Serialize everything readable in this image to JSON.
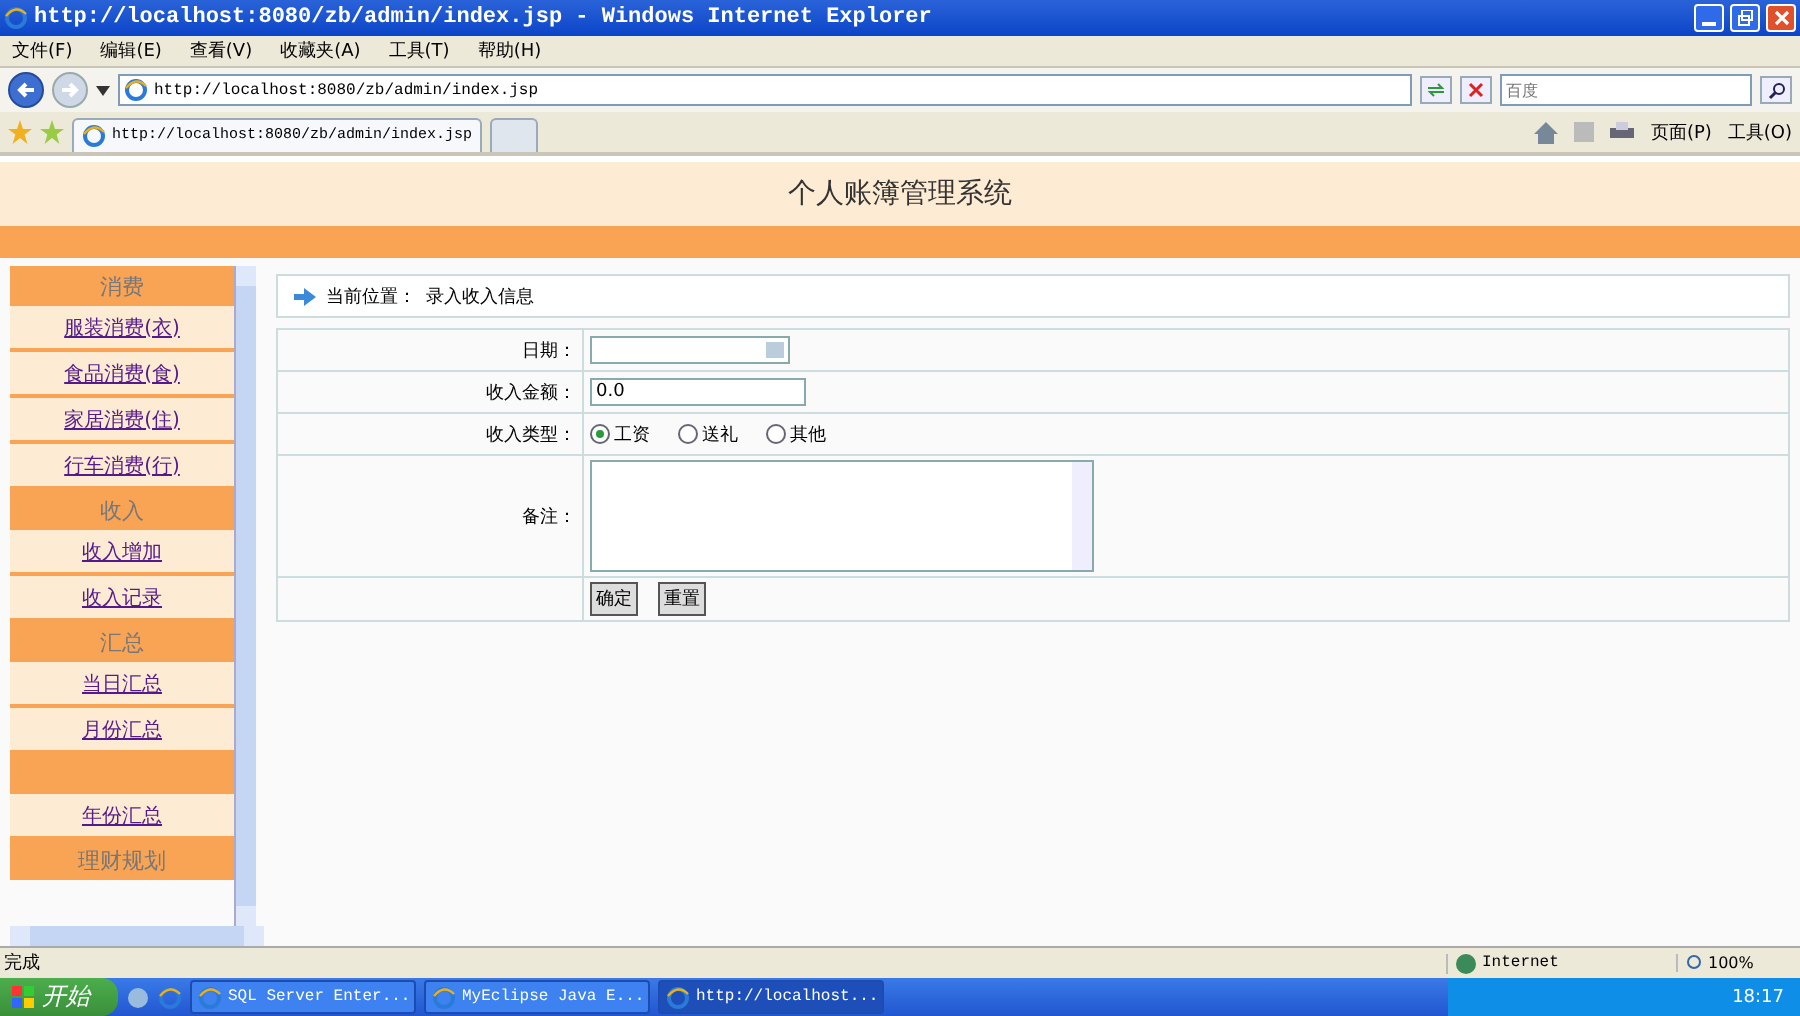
{
  "window": {
    "title": "http://localhost:8080/zb/admin/index.jsp - Windows Internet Explorer"
  },
  "menu": [
    "文件(F)",
    "编辑(E)",
    "查看(V)",
    "收藏夹(A)",
    "工具(T)",
    "帮助(H)"
  ],
  "address": {
    "value": "http://localhost:8080/zb/admin/index.jsp"
  },
  "search": {
    "placeholder": "百度"
  },
  "tabs": [
    {
      "label": "http://localhost:8080/zb/admin/index.jsp",
      "selected": true
    }
  ],
  "command_bar": [
    "页面(P)",
    "工具(O)"
  ],
  "page": {
    "title": "个人账簿管理系统",
    "sidebar": [
      {
        "header": "消费",
        "items": [
          "服装消费(衣)",
          "食品消费(食)",
          "家居消费(住)",
          "行车消费(行)"
        ]
      },
      {
        "header": "收入",
        "items": [
          "收入增加",
          "收入记录"
        ]
      },
      {
        "header": "汇总",
        "items": [
          "当日汇总",
          "月份汇总"
        ]
      },
      {
        "items": [
          "年份汇总"
        ]
      },
      {
        "header": "理财规划"
      }
    ],
    "breadcrumb": {
      "label": "当前位置：",
      "value": "录入收入信息"
    },
    "form": {
      "date_label": "日期：",
      "amount_label": "收入金额：",
      "amount_value": "0.0",
      "type_label": "收入类型：",
      "type_options": [
        {
          "label": "工资",
          "selected": true
        },
        {
          "label": "送礼",
          "selected": false
        },
        {
          "label": "其他",
          "selected": false
        }
      ],
      "remark_label": "备注：",
      "buttons": [
        "确定",
        "重置"
      ]
    }
  },
  "status_bar": {
    "text": "完成",
    "zone": "Internet",
    "zoom": "100%"
  },
  "taskbar": {
    "start": "开始",
    "tasks": [
      {
        "label": "SQL Server Enter...",
        "selected": false
      },
      {
        "label": "MyEclipse Java E...",
        "selected": false
      },
      {
        "label": "http://localhost...",
        "selected": true
      }
    ],
    "clock": "18:17"
  }
}
